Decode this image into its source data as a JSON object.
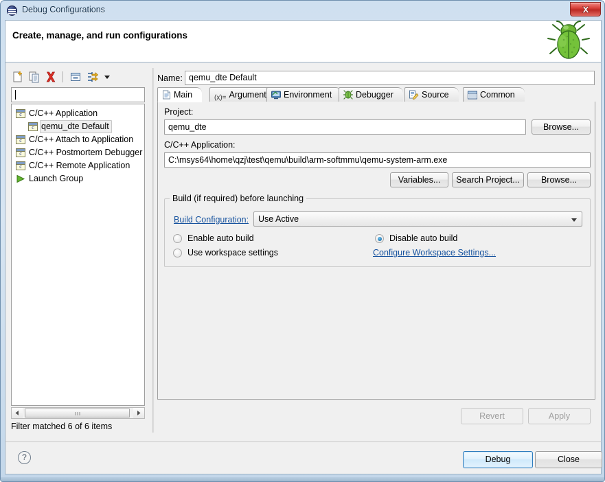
{
  "window": {
    "title": "Debug Configurations",
    "app_icon": "debug-configurations-icon",
    "close_label": "x"
  },
  "header": {
    "title": "Create, manage, and run configurations",
    "icon": "green-bug-icon"
  },
  "left_panel": {
    "toolbar": [
      {
        "name": "new-launch-configuration-icon",
        "tooltip": "New launch configuration"
      },
      {
        "name": "duplicate-icon",
        "tooltip": "Duplicate"
      },
      {
        "name": "delete-icon",
        "tooltip": "Delete"
      },
      {
        "name": "collapse-all-icon",
        "tooltip": "Collapse All"
      },
      {
        "name": "filter-icon",
        "tooltip": "Filter launch configurations"
      },
      {
        "name": "chevron-down-icon",
        "tooltip": "View Menu"
      }
    ],
    "filter_value": "",
    "filter_placeholder": "",
    "tree": [
      {
        "label": "C/C++ Application",
        "icon": "c-app-icon",
        "level": 0,
        "selected": false
      },
      {
        "label": "qemu_dte Default",
        "icon": "c-app-icon",
        "level": 1,
        "selected": true
      },
      {
        "label": "C/C++ Attach to Application",
        "icon": "c-app-icon",
        "level": 0,
        "selected": false
      },
      {
        "label": "C/C++ Postmortem Debugger",
        "icon": "c-app-icon",
        "level": 0,
        "selected": false
      },
      {
        "label": "C/C++ Remote Application",
        "icon": "c-app-icon",
        "level": 0,
        "selected": false
      },
      {
        "label": "Launch Group",
        "icon": "launch-group-icon",
        "level": 0,
        "selected": false
      }
    ],
    "status": "Filter matched 6 of 6 items"
  },
  "right_panel": {
    "name_label": "Name:",
    "name_value": "qemu_dte Default",
    "tabs": [
      {
        "label": "Main",
        "icon": "main-tab-icon",
        "active": true
      },
      {
        "label": "Arguments",
        "icon": "arguments-tab-icon",
        "active": false
      },
      {
        "label": "Environment",
        "icon": "environment-tab-icon",
        "active": false
      },
      {
        "label": "Debugger",
        "icon": "debugger-tab-icon",
        "active": false
      },
      {
        "label": "Source",
        "icon": "source-tab-icon",
        "active": false
      },
      {
        "label": "Common",
        "icon": "common-tab-icon",
        "active": false
      }
    ],
    "main": {
      "project_label": "Project:",
      "project_value": "qemu_dte",
      "project_browse_label": "Browse...",
      "application_label": "C/C++ Application:",
      "application_value": "C:\\msys64\\home\\qzj\\test\\qemu\\build\\arm-softmmu\\qemu-system-arm.exe",
      "variables_label": "Variables...",
      "search_project_label": "Search Project...",
      "app_browse_label": "Browse...",
      "build_group_title": "Build (if required) before launching",
      "build_configuration_link": "Build Configuration:",
      "build_configuration_value": "Use Active",
      "radio_enable_auto_build": "Enable auto build",
      "radio_disable_auto_build": "Disable auto build",
      "radio_use_workspace_settings": "Use workspace settings",
      "configure_workspace_link": "Configure Workspace Settings...",
      "selected_radio": "disable-auto-build"
    },
    "revert_label": "Revert",
    "apply_label": "Apply"
  },
  "footer": {
    "help_label": "?",
    "debug_label": "Debug",
    "close_label": "Close"
  },
  "colors": {
    "accent": "#2e7dbe",
    "link": "#16529e",
    "bug_green": "#5aa02c",
    "close_red": "#d9433c"
  }
}
